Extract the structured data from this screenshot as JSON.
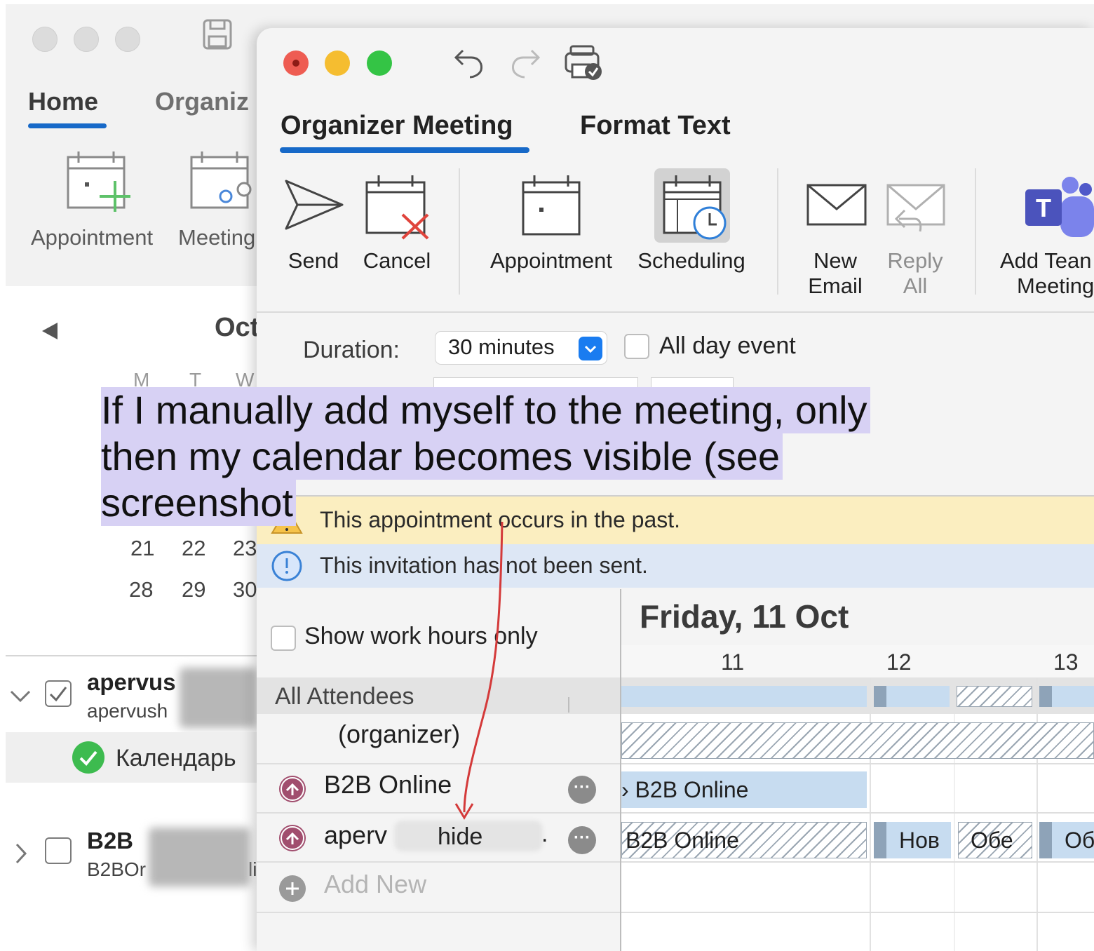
{
  "back_window": {
    "tabs": [
      "Home",
      "Organiz"
    ],
    "ribbon": {
      "appointment_label": "Appointment",
      "meeting_label": "Meeting"
    },
    "month_label": "Oct",
    "weekday_headers": [
      "M",
      "T",
      "W"
    ],
    "calendar_rows": [
      [
        "21",
        "22",
        "23"
      ],
      [
        "28",
        "29",
        "30"
      ]
    ],
    "accounts": [
      {
        "name": "apervus",
        "email": "apervush",
        "calendar": "Календарь",
        "checked": true
      },
      {
        "name": "B2B",
        "email": "B2BOr",
        "email_tail": "li",
        "checked": false
      }
    ]
  },
  "meeting_window": {
    "tabs": {
      "organizer_meeting": "Organizer Meeting",
      "format_text": "Format Text"
    },
    "toolbar": {
      "send": "Send",
      "cancel": "Cancel",
      "appointment": "Appointment",
      "scheduling": "Scheduling",
      "new_email": [
        "New",
        "Email"
      ],
      "reply_all": [
        "Reply",
        "All"
      ],
      "add_teams": [
        "Add Tean",
        "Meeting"
      ]
    },
    "duration": {
      "label": "Duration:",
      "value": "30 minutes"
    },
    "all_day": {
      "label": "All day event",
      "checked": false
    },
    "banners": {
      "past": "This appointment occurs in the past.",
      "not_sent": "This invitation has not been sent."
    },
    "show_work_hours": {
      "label": "Show work hours only",
      "checked": false
    },
    "attendees": {
      "header": "All Attendees",
      "organizer": "(organizer)",
      "rows": [
        {
          "name": "B2B Online"
        },
        {
          "name": "aperv",
          "redacted_label": "hide",
          "suffix": "."
        }
      ],
      "add_new": "Add New"
    },
    "schedule": {
      "day_title": "Friday, 11 Oct",
      "hours": [
        "11",
        "12",
        "13"
      ],
      "events": {
        "row1": "B2B Online",
        "row2": [
          "B2B Online",
          "Нов",
          "Обе",
          "Об"
        ]
      },
      "colors": {
        "busy": "#c7dcf0",
        "tentative_hatch": "#9aa6b2",
        "mark": "#8ea3b8"
      }
    }
  },
  "annotation": {
    "lines": [
      "If I manually add myself to the meeting, only",
      "then my calendar becomes visible (see",
      "screenshot"
    ],
    "highlight_color": "#d7d1f4",
    "arrow_color": "#d43a3a"
  }
}
